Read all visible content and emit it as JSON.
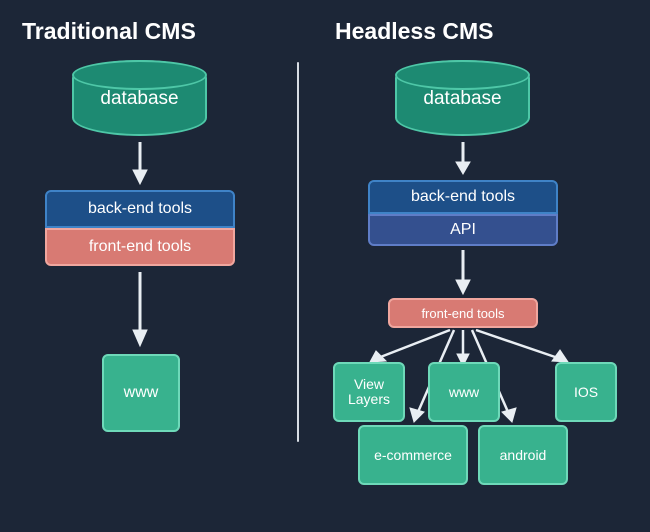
{
  "traditional": {
    "title": "Traditional CMS",
    "database": "database",
    "backend": "back-end tools",
    "frontend": "front-end tools",
    "www": "www"
  },
  "headless": {
    "title": "Headless CMS",
    "database": "database",
    "backend": "back-end tools",
    "api": "API",
    "frontend": "front-end tools",
    "outputs": {
      "view_layers_l1": "View",
      "view_layers_l2": "Layers",
      "ecommerce": "e-commerce",
      "www": "www",
      "android": "android",
      "ios": "IOS"
    }
  },
  "colors": {
    "bg": "#1c2637",
    "teal": "#1d8a72",
    "teal_border": "#4ec7a7",
    "blue": "#1d4f88",
    "blue2": "#34508f",
    "red": "#d87a73",
    "green": "#38b28e"
  }
}
